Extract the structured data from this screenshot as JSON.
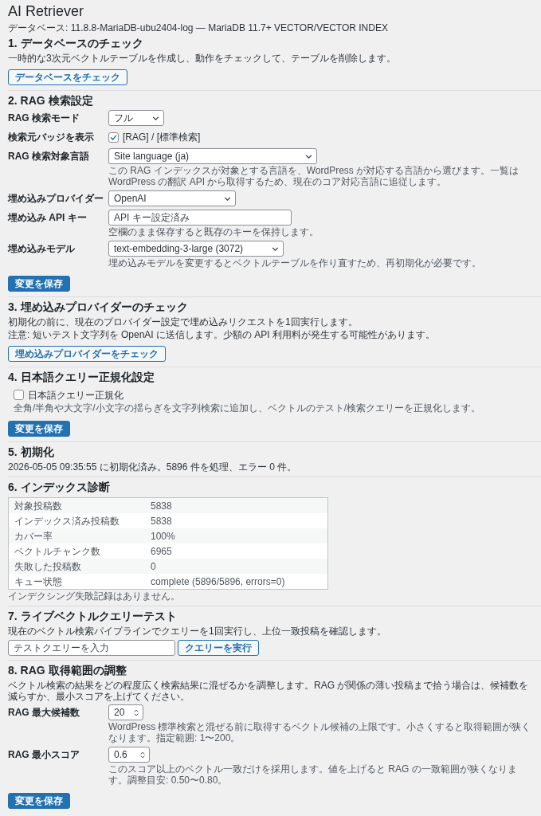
{
  "page": {
    "title": "AI Retriever",
    "database_info": "データベース: 11.8.8-MariaDB-ubu2404-log — MariaDB 11.7+ VECTOR/VECTOR INDEX"
  },
  "sections": [
    {
      "kind": "check",
      "heading": "1. データベースのチェック",
      "paragraphs": [
        "一時的な3次元ベクトルテーブルを作成し、動作をチェックして、テーブルを削除します。"
      ],
      "button": "データベースをチェック"
    },
    {
      "kind": "form",
      "heading": "2. RAG 検索設定",
      "fields": [
        {
          "kind": "select",
          "label": "RAG 検索モード",
          "value": "フル"
        },
        {
          "kind": "checkbox",
          "label": "検索元バッジを表示",
          "option": "[RAG] / [標準検索]",
          "checked": true
        },
        {
          "kind": "select",
          "label": "RAG 検索対象言語",
          "value": "Site language (ja)",
          "help": "この RAG インデックスが対象とする言語を、WordPress が対応する言語から選びます。一覧は WordPress の翻訳 API から取得するため、現在のコア対応言語に追従します。"
        },
        {
          "kind": "select",
          "label": "埋め込みプロバイダー",
          "value": "OpenAI"
        },
        {
          "kind": "text",
          "label": "埋め込み API キー",
          "placeholder": "API キー設定済み",
          "help": "空欄のまま保存すると既存のキーを保持します。"
        },
        {
          "kind": "select",
          "label": "埋め込みモデル",
          "value": "text-embedding-3-large (3072)",
          "help": "埋め込みモデルを変更するとベクトルテーブルを作り直すため、再初期化が必要です。"
        }
      ],
      "button": "変更を保存"
    },
    {
      "kind": "check",
      "heading": "3. 埋め込みプロバイダーのチェック",
      "paragraphs": [
        "初期化の前に、現在のプロバイダー設定で埋め込みリクエストを1回実行します。",
        "注意: 短いテスト文字列を OpenAI に送信します。少額の API 利用料が発生する可能性があります。"
      ],
      "button": "埋め込みプロバイダーをチェック"
    },
    {
      "kind": "form",
      "heading": "4. 日本語クエリー正規化設定",
      "fields": [
        {
          "kind": "standalone_checkbox",
          "option": "日本語クエリー正規化",
          "checked": false,
          "help": "全角/半角や大文字/小文字の揺らぎを文字列検索に追加し、ベクトルのテスト/検索クエリーを正規化します。"
        }
      ],
      "button": "変更を保存"
    },
    {
      "kind": "status",
      "heading": "5. 初期化",
      "paragraphs": [
        "2026-05-05 09:35:55 に初期化済み。5896 件を処理、エラー 0 件。"
      ]
    },
    {
      "kind": "table",
      "heading": "6. インデックス診断",
      "rows": [
        {
          "label": "対象投稿数",
          "value": "5838"
        },
        {
          "label": "インデックス済み投稿数",
          "value": "5838"
        },
        {
          "label": "カバー率",
          "value": "100%"
        },
        {
          "label": "ベクトルチャンク数",
          "value": "6965"
        },
        {
          "label": "失敗した投稿数",
          "value": "0"
        },
        {
          "label": "キュー状態",
          "value": "complete (5896/5896, errors=0)"
        }
      ],
      "note": "インデクシング失敗記録はありません。"
    },
    {
      "kind": "query",
      "heading": "7. ライブベクトルクエリーテスト",
      "paragraphs": [
        "現在のベクトル検索パイプラインでクエリーを1回実行し、上位一致投稿を確認します。"
      ],
      "input": {
        "placeholder": "テストクエリーを入力"
      },
      "button": "クエリーを実行"
    },
    {
      "kind": "form",
      "heading": "8. RAG 取得範囲の調整",
      "paragraphs": [
        "ベクトル検索の結果をどの程度広く検索結果に混ぜるかを調整します。RAG が関係の薄い投稿まで拾う場合は、候補数を減らすか、最小スコアを上げてください。"
      ],
      "fields": [
        {
          "kind": "number",
          "label": "RAG 最大候補数",
          "value": "20",
          "help": "WordPress 標準検索と混ぜる前に取得するベクトル候補の上限です。小さくすると取得範囲が狭くなります。指定範囲: 1〜200。"
        },
        {
          "kind": "number",
          "label": "RAG 最小スコア",
          "value": "0.6",
          "help": "このスコア以上のベクトル一致だけを採用します。値を上げると RAG の一致範囲が狭くなります。調整目安: 0.50〜0.80。"
        }
      ],
      "button": "変更を保存"
    }
  ]
}
